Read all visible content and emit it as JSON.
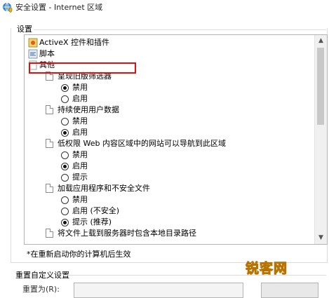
{
  "window": {
    "title": "安全设置 - Internet 区域"
  },
  "settings": {
    "group_label": "设置",
    "tree": [
      {
        "kind": "category",
        "icon": "gear-icon",
        "label": "ActiveX 控件和插件"
      },
      {
        "kind": "category",
        "icon": "script-icon",
        "label": "脚本"
      },
      {
        "kind": "category",
        "icon": "settings-document-icon",
        "label": "其他"
      },
      {
        "kind": "setting",
        "label": "呈现旧版筛选器"
      },
      {
        "kind": "option",
        "label": "禁用",
        "selected": true
      },
      {
        "kind": "option",
        "label": "启用",
        "selected": false
      },
      {
        "kind": "setting",
        "label": "持续使用用户数据"
      },
      {
        "kind": "option",
        "label": "禁用",
        "selected": false
      },
      {
        "kind": "option",
        "label": "启用",
        "selected": true
      },
      {
        "kind": "setting",
        "label": "低权限 Web 内容区域中的网站可以导航到此区域"
      },
      {
        "kind": "option",
        "label": "禁用",
        "selected": false
      },
      {
        "kind": "option",
        "label": "启用",
        "selected": true
      },
      {
        "kind": "option",
        "label": "提示",
        "selected": false
      },
      {
        "kind": "setting",
        "label": "加载应用程序和不安全文件"
      },
      {
        "kind": "option",
        "label": "禁用",
        "selected": false
      },
      {
        "kind": "option",
        "label": "启用 (不安全)",
        "selected": false
      },
      {
        "kind": "option",
        "label": "提示 (推荐)",
        "selected": true
      },
      {
        "kind": "setting",
        "label": "将文件上载到服务器时包含本地目录路径"
      }
    ],
    "footnote": "*在重新启动你的计算机后生效"
  },
  "reset": {
    "group_label": "重置自定义设置",
    "reset_to_label": "重置为(R):"
  },
  "watermark": "锐客网"
}
